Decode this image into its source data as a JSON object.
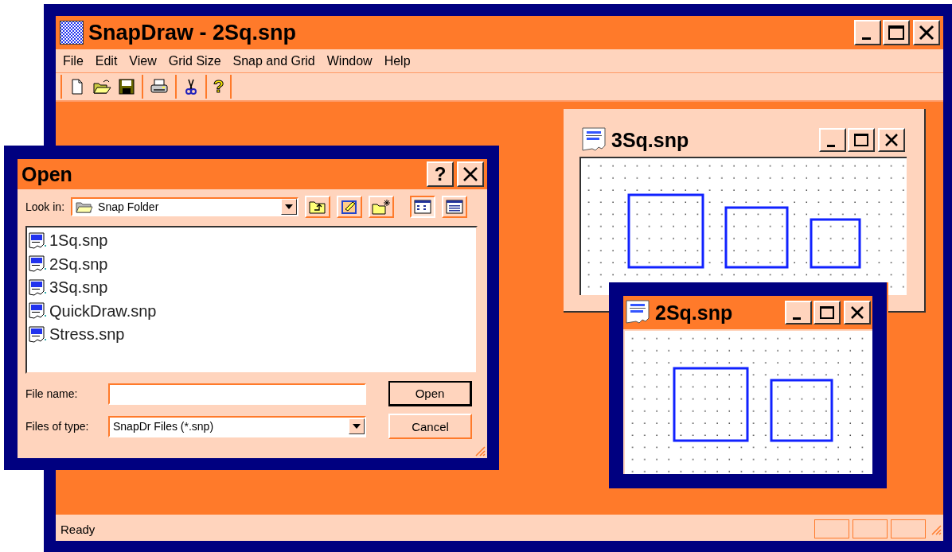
{
  "main_window": {
    "title": "SnapDraw - 2Sq.snp",
    "active": true
  },
  "menu": [
    "File",
    "Edit",
    "View",
    "Grid Size",
    "Snap and Grid",
    "Window",
    "Help"
  ],
  "toolbar": [
    [
      {
        "kind": "new"
      },
      {
        "kind": "open"
      },
      {
        "kind": "save"
      }
    ],
    [
      {
        "kind": "print"
      }
    ],
    [
      {
        "kind": "cut"
      }
    ],
    [
      {
        "kind": "help",
        "glyph": "?"
      }
    ]
  ],
  "documents": [
    {
      "title": "3Sq.snp",
      "active": false
    },
    {
      "title": "2Sq.snp",
      "active": true
    }
  ],
  "dialog": {
    "title": "Open",
    "help_button": "?",
    "look_in_label": "Look in:",
    "look_in_value": "Snap Folder",
    "nav_buttons": [
      {
        "kind": "up"
      },
      {
        "kind": "desktop"
      },
      {
        "kind": "new-folder"
      }
    ],
    "view_buttons": [
      {
        "kind": "list",
        "selected": true
      },
      {
        "kind": "details",
        "selected": false
      }
    ],
    "files": [
      {
        "name": "1Sq.snp"
      },
      {
        "name": "2Sq.snp"
      },
      {
        "name": "3Sq.snp"
      },
      {
        "name": "QuickDraw.snp"
      },
      {
        "name": "Stress.snp"
      }
    ],
    "file_name_label": "File name:",
    "file_type_label": "Files of type:",
    "file_type_value": "SnapDr Files (*.snp)",
    "buttons": [
      {
        "label": "Open",
        "kind": "default"
      },
      {
        "label": "Cancel",
        "kind": "normal"
      }
    ]
  },
  "status_bar": {
    "text": "Ready"
  }
}
